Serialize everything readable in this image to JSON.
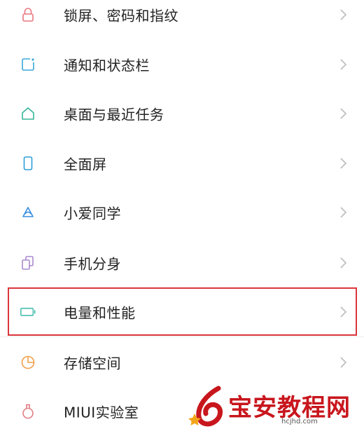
{
  "settings": {
    "items": [
      {
        "label": "锁屏、密码和指纹",
        "icon": "lock-icon",
        "color": "#e8787f"
      },
      {
        "label": "通知和状态栏",
        "icon": "notification-icon",
        "color": "#3aa7d8"
      },
      {
        "label": "桌面与最近任务",
        "icon": "home-icon",
        "color": "#39b59b"
      },
      {
        "label": "全面屏",
        "icon": "phone-icon",
        "color": "#2e9fd8"
      },
      {
        "label": "小爱同学",
        "icon": "xiaoai-icon",
        "color": "#3a8fe0"
      },
      {
        "label": "手机分身",
        "icon": "dual-phone-icon",
        "color": "#a98ad0"
      },
      {
        "label": "电量和性能",
        "icon": "battery-icon",
        "color": "#3cb9a8"
      },
      {
        "label": "存储空间",
        "icon": "storage-icon",
        "color": "#f0a04a"
      },
      {
        "label": "MIUI实验室",
        "icon": "flask-icon",
        "color": "#e07f86"
      }
    ],
    "highlighted_index": 6,
    "highlight_color": "#d9363b"
  },
  "watermark": {
    "title": "宝安教程网",
    "url": "hcjhd.com",
    "color": "#c8161d"
  }
}
